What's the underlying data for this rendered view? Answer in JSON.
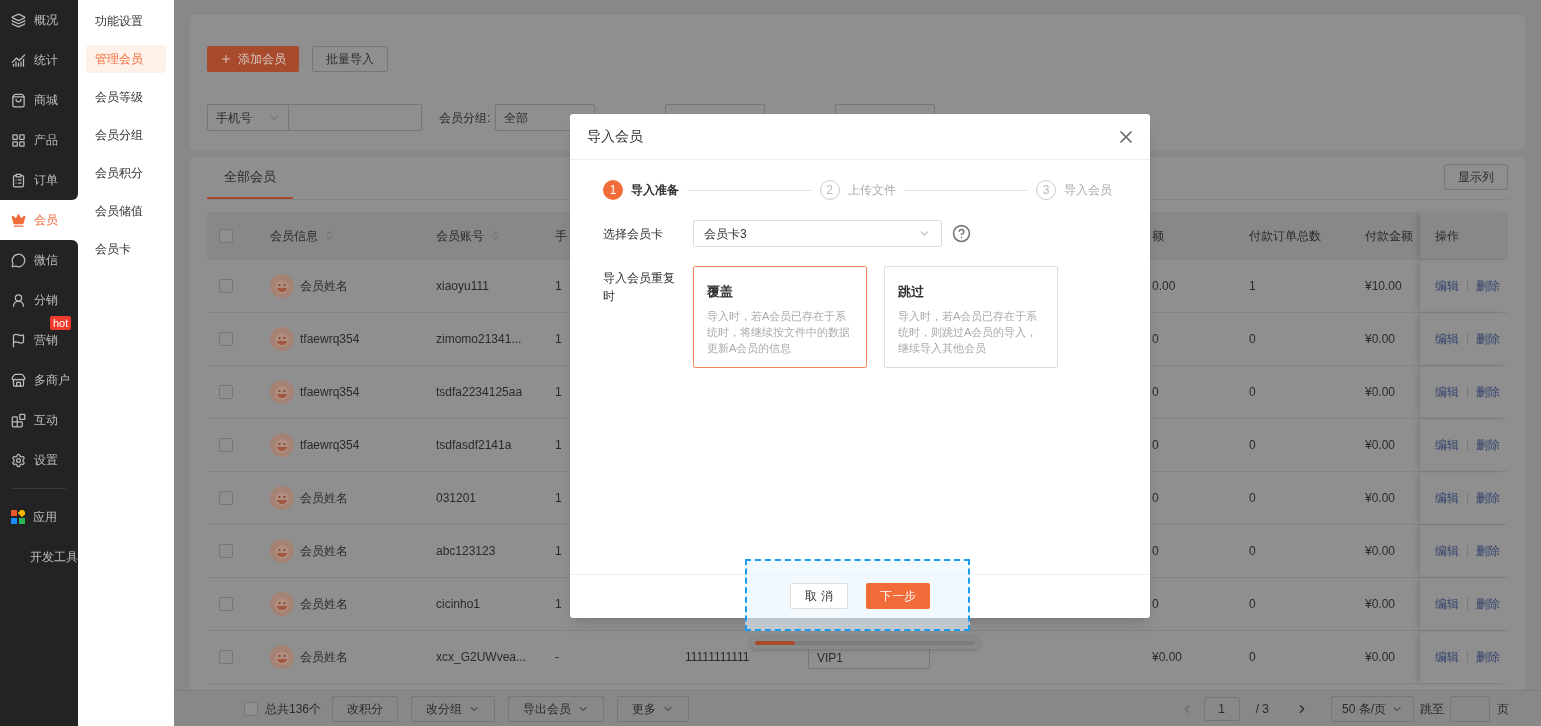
{
  "sidebar": {
    "groups": [
      [
        {
          "label": "概况",
          "selected": false
        },
        {
          "label": "统计",
          "selected": false
        },
        {
          "label": "商城",
          "selected": false
        },
        {
          "label": "产品",
          "selected": false
        },
        {
          "label": "订单",
          "selected": false
        },
        {
          "label": "会员",
          "selected": true
        },
        {
          "label": "微信",
          "selected": false
        },
        {
          "label": "分销",
          "selected": false
        },
        {
          "label": "营销",
          "selected": false,
          "badge": "hot"
        },
        {
          "label": "多商户",
          "selected": false
        },
        {
          "label": "互动",
          "selected": false
        },
        {
          "label": "设置",
          "selected": false
        }
      ],
      [
        {
          "label": "应用",
          "selected": false
        },
        {
          "label": "开发工具",
          "selected": false
        }
      ]
    ]
  },
  "submenu": {
    "items": [
      {
        "label": "功能设置",
        "selected": false
      },
      {
        "label": "管理会员",
        "selected": true
      },
      {
        "label": "会员等级",
        "selected": false
      },
      {
        "label": "会员分组",
        "selected": false
      },
      {
        "label": "会员积分",
        "selected": false
      },
      {
        "label": "会员储值",
        "selected": false
      },
      {
        "label": "会员卡",
        "selected": false
      }
    ]
  },
  "toolbar": {
    "buttons": [
      {
        "label": "添加会员",
        "kind": "primary"
      },
      {
        "label": "批量导入",
        "kind": "default"
      }
    ]
  },
  "filters": {
    "type_select": "手机号",
    "group_label": "会员分组:",
    "group_select": "全部"
  },
  "table": {
    "tab": {
      "label": "全部会员",
      "selected": true
    },
    "columns_button": "显示列",
    "select_all": {
      "checked": false
    },
    "columns": {
      "info": "会员信息",
      "account": "会员账号",
      "phone": "手",
      "balance": "额",
      "orders": "付款订单总数",
      "amount": "付款金额",
      "actions": "操作"
    },
    "rows": [
      {
        "checked": false,
        "name": "会员姓名",
        "account": "xiaoyu111",
        "phone": "1",
        "balance": "0.00",
        "orders": "1",
        "amount": "¥10.00",
        "actions": [
          "编辑",
          "删除"
        ]
      },
      {
        "checked": false,
        "name": "tfaewrq354",
        "account": "zimomo21341...",
        "phone": "1",
        "balance": "0",
        "orders": "0",
        "amount": "¥0.00",
        "actions": [
          "编辑",
          "删除"
        ]
      },
      {
        "checked": false,
        "name": "tfaewrq354",
        "account": "tsdfa2234125aa",
        "phone": "1",
        "balance": "0",
        "orders": "0",
        "amount": "¥0.00",
        "actions": [
          "编辑",
          "删除"
        ]
      },
      {
        "checked": false,
        "name": "tfaewrq354",
        "account": "tsdfasdf2141a",
        "phone": "1",
        "balance": "0",
        "orders": "0",
        "amount": "¥0.00",
        "actions": [
          "编辑",
          "删除"
        ]
      },
      {
        "checked": false,
        "name": "会员姓名",
        "account": "031201",
        "phone": "1",
        "balance": "0",
        "orders": "0",
        "amount": "¥0.00",
        "actions": [
          "编辑",
          "删除"
        ]
      },
      {
        "checked": false,
        "name": "会员姓名",
        "account": "abc123123",
        "phone": "1",
        "balance": "0",
        "orders": "0",
        "amount": "¥0.00",
        "actions": [
          "编辑",
          "删除"
        ]
      },
      {
        "checked": false,
        "name": "会员姓名",
        "account": "cicinho1",
        "phone": "1",
        "balance": "0",
        "orders": "0",
        "amount": "¥0.00",
        "actions": [
          "编辑",
          "删除"
        ]
      },
      {
        "checked": false,
        "name": "会员姓名",
        "account": "xcx_G2UWvea...",
        "phone": "-",
        "column_5": "11111111111",
        "level_tag": "VIP1",
        "balance": "¥0.00",
        "orders": "0",
        "amount": "¥0.00",
        "actions": [
          "编辑",
          "删除"
        ]
      }
    ]
  },
  "footer": {
    "select_all": {
      "checked": false
    },
    "total": "总共136个",
    "buttons": [
      {
        "label": "改积分",
        "dropdown": false
      },
      {
        "label": "改分组",
        "dropdown": true
      },
      {
        "label": "导出会员",
        "dropdown": true
      },
      {
        "label": "更多",
        "dropdown": true
      }
    ],
    "page": "1",
    "pages": "/ 3",
    "page_size": "50 条/页",
    "jump_label": "跳至",
    "jump_suffix": "页"
  },
  "progress": {
    "level": 0.18
  },
  "dialog": {
    "title": "导入会员",
    "steps": [
      {
        "number": "1",
        "label": "导入准备",
        "selected": true
      },
      {
        "number": "2",
        "label": "上传文件",
        "selected": false
      },
      {
        "number": "3",
        "label": "导入会员",
        "selected": false
      }
    ],
    "card_field": {
      "label": "选择会员卡",
      "value": "会员卡3"
    },
    "duplicate_field": {
      "label": "导入会员重复时",
      "options": [
        {
          "title": "覆盖",
          "description": "导入时，若A会员已存在于系统时，将继续按文件中的数据更新A会员的信息",
          "selected": true
        },
        {
          "title": "跳过",
          "description": "导入时，若A会员已存在于系统时，则跳过A会员的导入，继续导入其他会员",
          "selected": false
        }
      ]
    },
    "buttons": [
      {
        "label": "取 消",
        "kind": "default"
      },
      {
        "label": "下一步",
        "kind": "primary"
      }
    ]
  }
}
